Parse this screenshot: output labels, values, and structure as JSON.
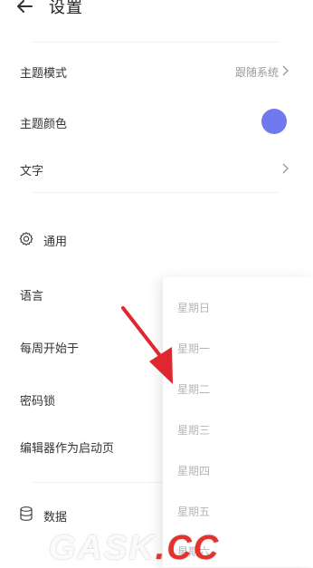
{
  "header": {
    "title": "设置",
    "back_icon": "back-arrow-icon"
  },
  "settings": {
    "theme_mode": {
      "label": "主题模式",
      "value": "跟随系统"
    },
    "theme_color": {
      "label": "主题颜色",
      "color": "#7079ee"
    },
    "text": {
      "label": "文字"
    }
  },
  "general": {
    "section_label": "通用",
    "section_icon": "gear-icon",
    "language": {
      "label": "语言"
    },
    "week_start": {
      "label": "每周开始于"
    },
    "password_lock": {
      "label": "密码锁"
    },
    "editor_start": {
      "label": "编辑器作为启动页"
    }
  },
  "data_section": {
    "label": "数据",
    "icon": "database-icon"
  },
  "weekday_picker": {
    "options": [
      "星期日",
      "星期一",
      "星期二",
      "星期三",
      "星期四",
      "星期五",
      "星期六"
    ]
  },
  "watermark": {
    "text_a": "GASK",
    "text_b": ".CC"
  },
  "colors": {
    "accent": "#7079ee",
    "arrow": "#e0262e"
  }
}
